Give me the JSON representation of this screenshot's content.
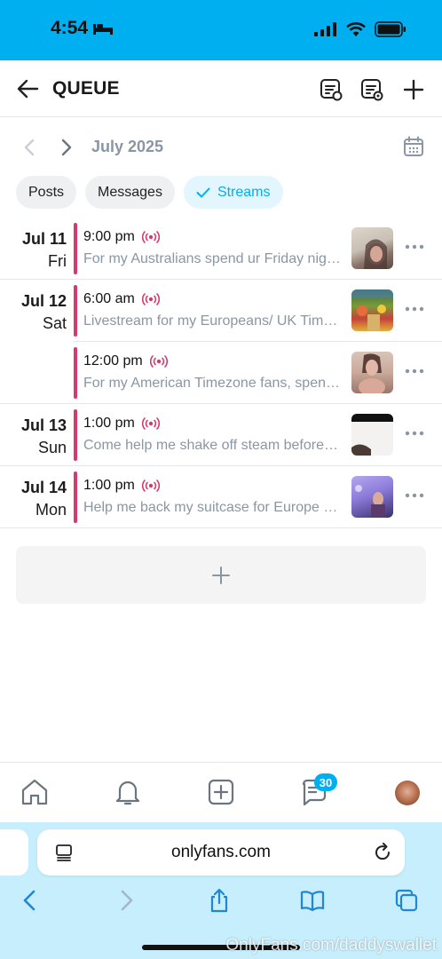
{
  "status": {
    "time": "4:54"
  },
  "header": {
    "title": "QUEUE"
  },
  "calendar": {
    "month": "July 2025"
  },
  "filters": [
    {
      "label": "Posts"
    },
    {
      "label": "Messages"
    },
    {
      "label": "Streams",
      "active": true
    }
  ],
  "queue": [
    {
      "date": "Jul 11",
      "day": "Fri",
      "time": "9:00 pm",
      "text": "For my Australians spend ur Friday night with me",
      "thumb_colors": [
        "#c9bfb3",
        "#6e5a52"
      ]
    },
    {
      "date": "Jul 12",
      "day": "Sat",
      "time": "6:00 am",
      "text": "Livestream for my Europeans/ UK Timezone",
      "thumb_colors": [
        "#7a9a3a",
        "#c6423a"
      ]
    },
    {
      "date": "",
      "day": "",
      "time": "12:00 pm",
      "text": "For my American Timezone fans, spend your day with me",
      "thumb_colors": [
        "#c9a99a",
        "#5a4038"
      ]
    },
    {
      "date": "Jul 13",
      "day": "Sun",
      "time": "1:00 pm",
      "text": "Come help me shake off steam before travel",
      "thumb_colors": [
        "#ffffff",
        "#111111"
      ]
    },
    {
      "date": "Jul 14",
      "day": "Mon",
      "time": "1:00 pm",
      "text": "Help me back my suitcase for Europe trip",
      "thumb_colors": [
        "#8b7bd8",
        "#3a2f6a"
      ]
    }
  ],
  "tabbar": {
    "messages_badge": "30"
  },
  "browser": {
    "url": "onlyfans.com"
  },
  "watermark": "OnlyFans.com/daddyswallet",
  "colors": {
    "brand": "#00aff0",
    "accent_bar": "#d33a6e",
    "muted": "#8a96a3"
  }
}
